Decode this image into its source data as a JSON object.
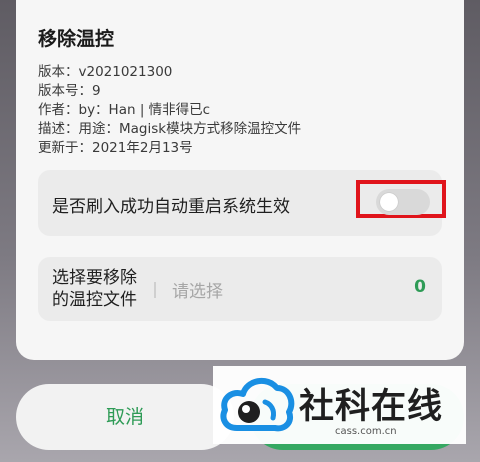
{
  "dialog": {
    "title": "移除温控",
    "info": [
      "版本：v2021021300",
      "版本号：9",
      "作者：by：Han | 情非得已c",
      "描述：用途：Magisk模块方式移除温控文件",
      "更新于：2021年2月13号"
    ],
    "toggle": {
      "label": "是否刷入成功自动重启系统生效",
      "on": false
    },
    "select": {
      "label_line1": "选择要移除",
      "label_line2": "的温控文件",
      "placeholder": "请选择",
      "count": "0"
    }
  },
  "buttons": {
    "cancel_label": "取消"
  },
  "watermark": {
    "text": "社科在线",
    "url": "cass.com.cn"
  },
  "colors": {
    "accent": "#2e9b56",
    "highlight": "#e0141b",
    "logo_blue": "#1a8fe3"
  }
}
